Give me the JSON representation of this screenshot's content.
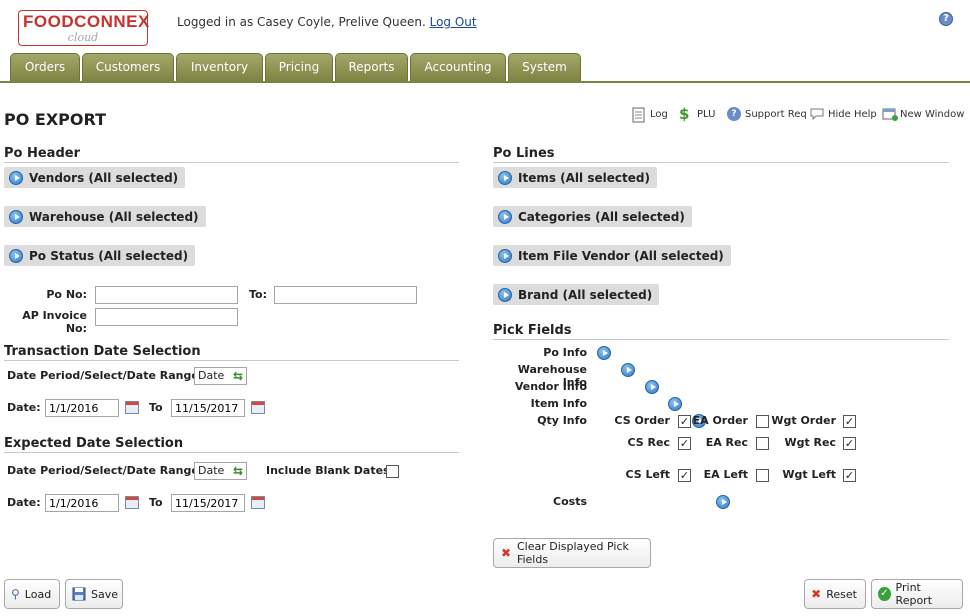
{
  "logo": {
    "main": "FOODCONNEX",
    "sub": "cloud"
  },
  "header": {
    "logged_in": "Logged in as Casey Coyle, Prelive Queen.",
    "logout": "Log Out",
    "help": "?"
  },
  "nav": [
    "Orders",
    "Customers",
    "Inventory",
    "Pricing",
    "Reports",
    "Accounting",
    "System"
  ],
  "page": {
    "title": "PO EXPORT"
  },
  "toolbar": {
    "log": "Log",
    "plu": "PLU",
    "support": "Support Req",
    "hide_help": "Hide Help",
    "new_window": "New Window"
  },
  "po_header": {
    "title": "Po Header",
    "filters": [
      "Vendors (All selected)",
      "Warehouse (All selected)",
      "Po Status (All selected)"
    ],
    "po_no_label": "Po No:",
    "po_no": "",
    "to_label": "To:",
    "po_to": "",
    "ap_invoice_label": "AP Invoice No:",
    "ap_invoice": ""
  },
  "transaction_date": {
    "title": "Transaction Date Selection",
    "period_label": "Date Period/Select/Date Range",
    "period_value": "Date",
    "date_label": "Date:",
    "from": "1/1/2016",
    "to_label": "To",
    "to": "11/15/2017"
  },
  "expected_date": {
    "title": "Expected Date Selection",
    "period_label": "Date Period/Select/Date Range",
    "period_value": "Date",
    "include_blank_label": "Include Blank Dates",
    "include_blank_checked": false,
    "date_label": "Date:",
    "from": "1/1/2016",
    "to_label": "To",
    "to": "11/15/2017"
  },
  "po_lines": {
    "title": "Po Lines",
    "filters": [
      "Items (All selected)",
      "Categories (All selected)",
      "Item File Vendor (All selected)",
      "Brand (All selected)"
    ]
  },
  "pick_fields": {
    "title": "Pick Fields",
    "rows": [
      "Po Info",
      "Warehouse Info",
      "Vendor Info",
      "Item Info",
      "Qty Info"
    ],
    "qty": [
      [
        {
          "label": "CS Order",
          "checked": true
        },
        {
          "label": "EA Order",
          "checked": false
        },
        {
          "label": "Wgt Order",
          "checked": true
        }
      ],
      [
        {
          "label": "CS Rec",
          "checked": true
        },
        {
          "label": "EA Rec",
          "checked": false
        },
        {
          "label": "Wgt Rec",
          "checked": true
        }
      ],
      [
        {
          "label": "CS Left",
          "checked": true
        },
        {
          "label": "EA Left",
          "checked": false
        },
        {
          "label": "Wgt Left",
          "checked": true
        }
      ]
    ],
    "costs": "Costs",
    "clear_button": "Clear Displayed Pick Fields"
  },
  "buttons": {
    "load": "Load",
    "save": "Save",
    "reset": "Reset",
    "print": "Print Report"
  },
  "colors": {
    "nav_tab": "#8f944f",
    "logo_red": "#c8322e",
    "accent_blue": "#2b78c6"
  }
}
